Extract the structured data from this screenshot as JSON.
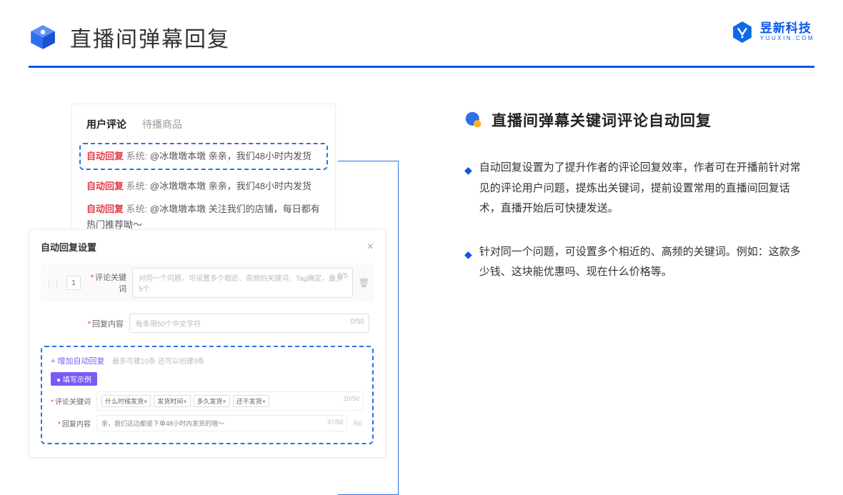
{
  "header": {
    "title": "直播间弹幕回复",
    "brand_name": "昱新科技",
    "brand_sub": "YUUXIN.COM"
  },
  "comment_card": {
    "tabs": {
      "active": "用户评论",
      "inactive": "待播商品"
    },
    "highlighted": {
      "tag": "自动回复",
      "sys": "系统:",
      "text": "@冰墩墩本墩 亲亲，我们48小时内发货"
    },
    "line2": {
      "tag": "自动回复",
      "sys": "系统:",
      "text": "@冰墩墩本墩 亲亲，我们48小时内发货"
    },
    "line3": {
      "tag": "自动回复",
      "sys": "系统:",
      "text": "@冰墩墩本墩 关注我们的店铺，每日都有热门推荐呦～"
    }
  },
  "settings": {
    "title": "自动回复设置",
    "row1": {
      "num": "1",
      "label": "评论关键词",
      "placeholder": "对同一个问题，可设置多个相近、高频的关键词，Tag确定，最多5个",
      "counter": "0/5"
    },
    "row2": {
      "label": "回复内容",
      "placeholder": "每条限50个中文字符",
      "counter": "0/50"
    },
    "add_link": "+ 增加自动回复",
    "add_hint": "最多可建10条 还可以创建9条",
    "example_badge": "● 填写示例",
    "ex_row1": {
      "label": "评论关键词",
      "tags": [
        "什么时候发货×",
        "发货时间×",
        "多久发货×",
        "还不发货×"
      ],
      "counter": "20/50"
    },
    "ex_row2": {
      "label": "回复内容",
      "text": "亲，我们这边都是下单48小时内发货的哦～",
      "counter": "37/50"
    },
    "outer_counter": "/50"
  },
  "right": {
    "section_title": "直播间弹幕关键词评论自动回复",
    "bullet1": "自动回复设置为了提升作者的评论回复效率，作者可在开播前针对常见的评论用户问题，提炼出关键词，提前设置常用的直播间回复话术，直播开始后可快捷发送。",
    "bullet2": "针对同一个问题，可设置多个相近的、高频的关键词。例如：这款多少钱、这块能优惠吗、现在什么价格等。"
  }
}
